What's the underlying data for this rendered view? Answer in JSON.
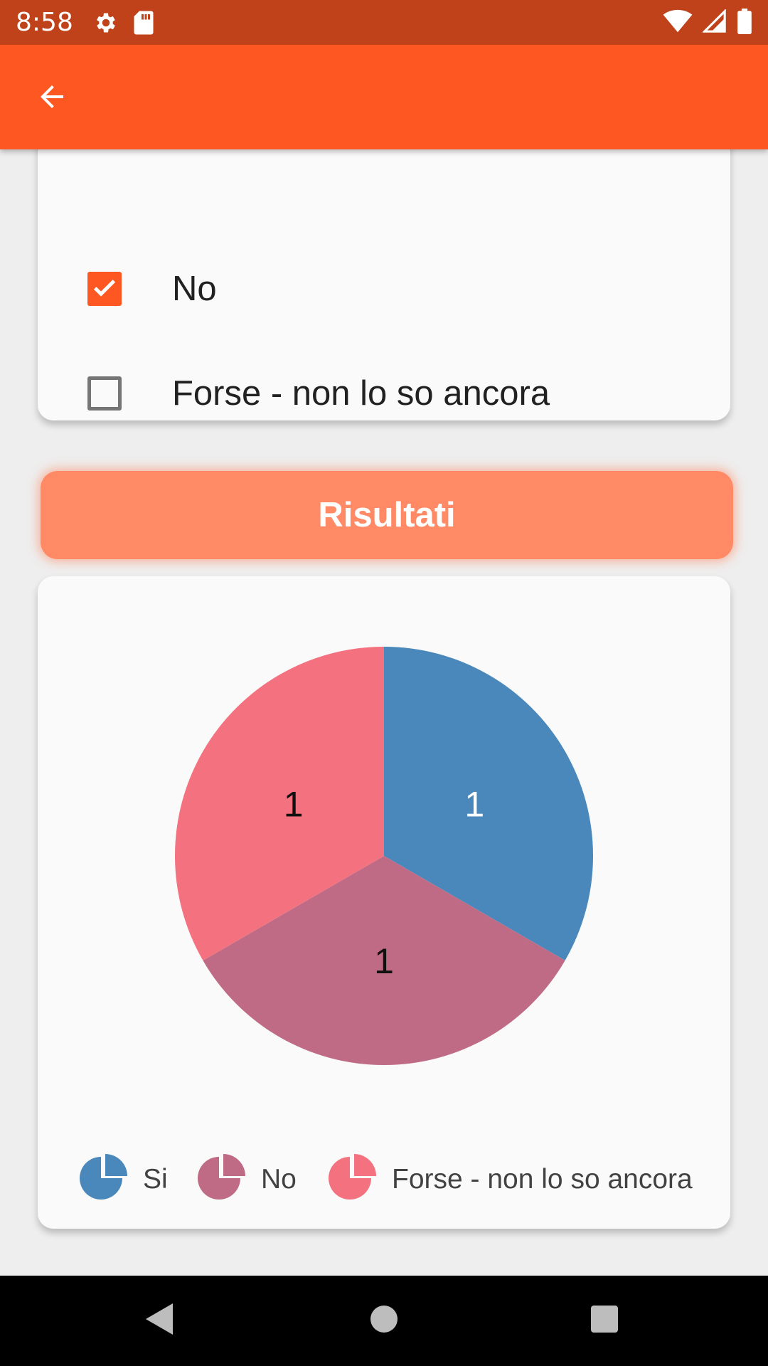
{
  "status_bar": {
    "time": "8:58",
    "left_icons": [
      "gear-icon",
      "sd-card-icon"
    ],
    "right_icons": [
      "wifi-icon",
      "signal-icon",
      "battery-icon"
    ]
  },
  "app_bar": {
    "color": "#ff5722",
    "back_icon": "arrow-back-icon"
  },
  "options": [
    {
      "label": "Si",
      "checked": false
    },
    {
      "label": "No",
      "checked": true
    },
    {
      "label": "Forse - non lo so ancora",
      "checked": false
    }
  ],
  "results_button": {
    "label": "Risultati",
    "color": "#ff8a65"
  },
  "chart_data": {
    "type": "pie",
    "categories": [
      "Si",
      "No",
      "Forse - non lo so ancora"
    ],
    "values": [
      1,
      1,
      1
    ],
    "data_labels": [
      "1",
      "1",
      "1"
    ],
    "colors": [
      "#4a88bb",
      "#c06b85",
      "#f47280"
    ],
    "legend_position": "bottom"
  },
  "nav_bar": {
    "buttons": [
      "back-triangle-icon",
      "home-circle-icon",
      "recents-square-icon"
    ]
  }
}
